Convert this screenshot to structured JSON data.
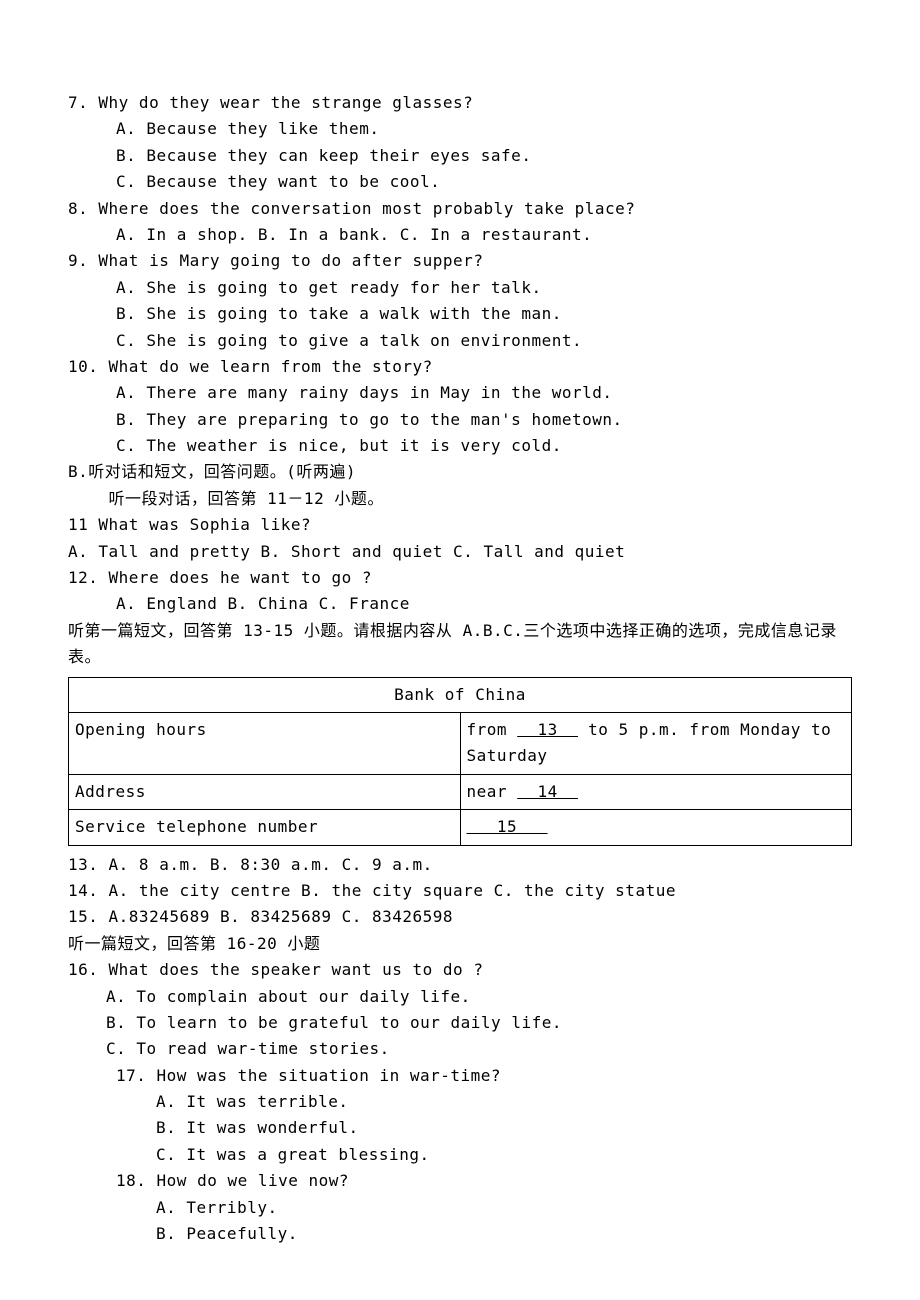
{
  "q7": {
    "text": "7. Why do they wear the strange glasses?",
    "a": "A. Because they like them.",
    "b": "B. Because they can keep their eyes safe.",
    "c": "C. Because they want to be cool."
  },
  "q8": {
    "text": "8.  Where does the conversation most probably take place?",
    "options": "A. In a shop.    B. In a bank.   C. In a restaurant."
  },
  "q9": {
    "text": "9. What is Mary going to do after supper?",
    "a": "A. She is going to get ready for her talk.",
    "b": "B. She is going to take a walk with the man.",
    "c": "C. She is going to give a talk on environment."
  },
  "q10": {
    "text": "10. What do we learn from the story?",
    "a": "A. There are many rainy days in May in the world.",
    "b": "B. They are preparing to go to the man's hometown.",
    "c": "C. The weather is nice, but it is very cold."
  },
  "sectionB": {
    "title": "B.听对话和短文，回答问题。(听两遍)",
    "sub": "    听一段对话，回答第 11－12 小题。"
  },
  "q11": {
    "text": "11  What was Sophia like?",
    "options": " A. Tall and pretty   B. Short and quiet    C. Tall and quiet"
  },
  "q12": {
    "text": "12. Where does he want to go ?",
    "options": "A. England  B. China   C. France"
  },
  "passage1": "听第一篇短文，回答第 13-15 小题。请根据内容从 A.B.C.三个选项中选择正确的选项，完成信息记录表。",
  "table": {
    "header": "Bank of China",
    "row1_label": "Opening hours",
    "row1_value_a": "from ",
    "row1_blank": "  13  ",
    "row1_value_b": " to 5 p.m. from Monday to Saturday",
    "row2_label": "Address",
    "row2_value_a": "near ",
    "row2_blank": "  14  ",
    "row3_label": "Service telephone number",
    "row3_blank": "   15   "
  },
  "q13": "13.  A. 8 a.m.    B. 8:30 a.m.    C. 9 a.m.",
  "q14": "14.  A. the city centre   B. the city square   C. the city statue",
  "q15": "15.  A.83245689     B. 83425689      C. 83426598",
  "passage2": "听一篇短文，回答第 16-20 小题",
  "q16": {
    "text": "16. What does the speaker want us to do ?",
    "a": "A. To complain about our daily life.",
    "b": "B. To learn to be grateful to our daily life.",
    "c": "C. To read war-time stories."
  },
  "q17": {
    "text": "17. How was the situation in war-time?",
    "a": "A. It was terrible.",
    "b": "B. It was wonderful.",
    "c": "C. It was a great blessing."
  },
  "q18": {
    "text": "18. How do we live now?",
    "a": "A. Terribly.",
    "b": "B. Peacefully."
  }
}
